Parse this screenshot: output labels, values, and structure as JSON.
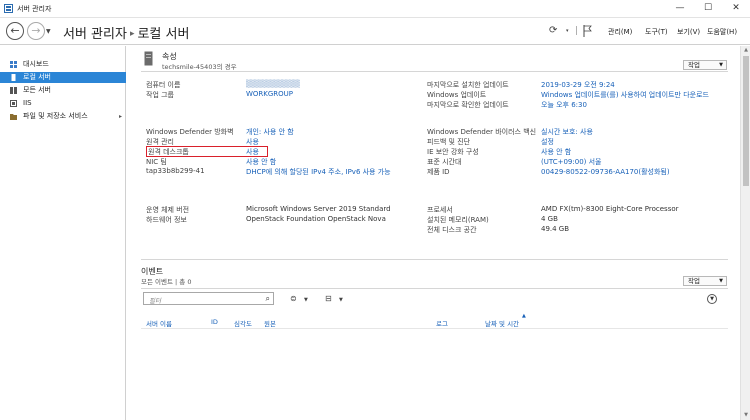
{
  "window": {
    "title": "서버 관리자",
    "controls": {
      "minimize": "—",
      "maximize": "☐",
      "close": "✕"
    }
  },
  "header": {
    "breadcrumb_root": "서버 관리자",
    "breadcrumb_separator": "▸",
    "breadcrumb_current": "로컬 서버",
    "menus": [
      "관리(M)",
      "도구(T)",
      "보기(V)",
      "도움말(H)"
    ]
  },
  "sidebar": {
    "items": [
      {
        "label": "대시보드",
        "icon": "dashboard-icon",
        "selected": false
      },
      {
        "label": "로컬 서버",
        "icon": "local-server-icon",
        "selected": true
      },
      {
        "label": "모든 서버",
        "icon": "all-servers-icon",
        "selected": false
      },
      {
        "label": "IIS",
        "icon": "iis-icon",
        "selected": false
      },
      {
        "label": "파일 및 저장소 서비스",
        "icon": "file-storage-icon",
        "selected": false,
        "arrow": "▸"
      }
    ]
  },
  "properties": {
    "title": "속성",
    "subtitle": "techsmile-45403의 경우",
    "tasks_label": "작업",
    "left": [
      {
        "label": "컴퓨터 이름",
        "value": ""
      },
      {
        "label": "작업 그룹",
        "value": "WORKGROUP"
      },
      {
        "label": "Windows Defender 방화벽",
        "value": "개인: 사용 안 함"
      },
      {
        "label": "원격 관리",
        "value": "사용"
      },
      {
        "label": "원격 데스크톱",
        "value": "사용"
      },
      {
        "label": "NIC 팀",
        "value": "사용 안 함"
      },
      {
        "label": "tap33b8b299-41",
        "value": "DHCP에 의해 할당된 IPv4 주소, IPv6 사용 가능"
      },
      {
        "label": "운영 체제 버전",
        "value": "Microsoft Windows Server 2019 Standard"
      },
      {
        "label": "하드웨어 정보",
        "value": "OpenStack Foundation OpenStack Nova"
      }
    ],
    "right": [
      {
        "label": "마지막으로 설치한 업데이트",
        "value": "2019-03-29 오전 9:24"
      },
      {
        "label": "Windows 업데이트",
        "value": "Windows 업데이트를(를) 사용하여 업데이트만 다운로드"
      },
      {
        "label": "마지막으로 확인한 업데이트",
        "value": "오늘 오후 6:30"
      },
      {
        "label": "Windows Defender 바이러스 백신",
        "value": "실시간 보호: 사용"
      },
      {
        "label": "피드백 및 진단",
        "value": "설정"
      },
      {
        "label": "IE 보안 강화 구성",
        "value": "사용 안 함"
      },
      {
        "label": "표준 시간대",
        "value": "(UTC+09:00) 서울"
      },
      {
        "label": "제품 ID",
        "value": "00429-80522-09736-AA170(활성화됨)"
      },
      {
        "label": "프로세서",
        "value": "AMD FX(tm)-8300 Eight-Core Processor"
      },
      {
        "label": "설치된 메모리(RAM)",
        "value": "4 GB"
      },
      {
        "label": "전체 디스크 공간",
        "value": "49.4 GB"
      }
    ]
  },
  "events": {
    "title": "이벤트",
    "subtitle": "모든 이벤트 | 총 0",
    "tasks_label": "작업",
    "filter_placeholder": "필터",
    "columns": [
      "서버 이름",
      "ID",
      "심각도",
      "원본",
      "로그",
      "날짜 및 시간"
    ]
  },
  "colors": {
    "accent": "#2b85d6",
    "link": "#1760b8",
    "highlight_box": "#d9202b"
  }
}
